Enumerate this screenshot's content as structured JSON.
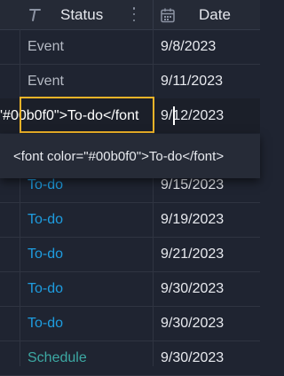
{
  "header": {
    "status_label": "Status",
    "date_label": "Date"
  },
  "rows": [
    {
      "status": "Event",
      "date": "9/8/2023"
    },
    {
      "status": "Event",
      "date": "9/11/2023"
    },
    {
      "status": "To-do",
      "date": "9/15/2023"
    },
    {
      "status": "To-do",
      "date": "9/19/2023"
    },
    {
      "status": "To-do",
      "date": "9/21/2023"
    },
    {
      "status": "To-do",
      "date": "9/30/2023"
    },
    {
      "status": "To-do",
      "date": "9/30/2023"
    },
    {
      "status": "Schedule",
      "date": "9/30/2023"
    }
  ],
  "editor": {
    "value": "'#00b0f0\">To-do</font",
    "date": "9/12/2023"
  },
  "suggestion": {
    "text": "<font color=\"#00b0f0\">To-do</font>"
  },
  "colors": {
    "event": "#b5bac4",
    "todo": "#1e9de0",
    "schedule": "#3da9a4",
    "focus_border": "#f0b429"
  }
}
